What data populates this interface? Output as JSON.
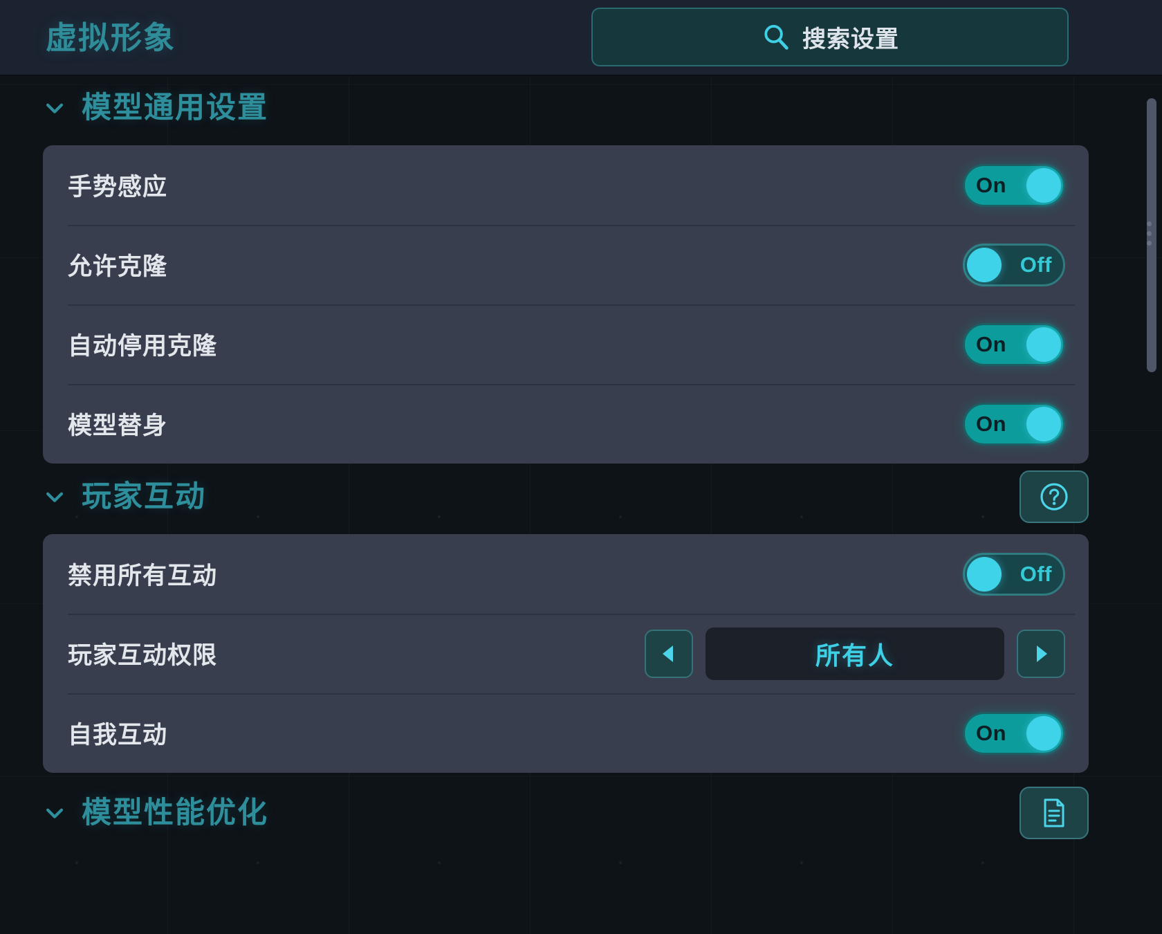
{
  "header": {
    "title": "虚拟形象",
    "search": {
      "label": "搜索设置",
      "icon": "search-icon"
    }
  },
  "theme": {
    "accent_teal": "#2e8e9b",
    "accent_cyan": "#3fd0e6",
    "toggle_on_bg": "#0d9c9c",
    "toggle_off_bg": "#17454a",
    "card_bg": "#383e4d",
    "header_bg": "#1b2230",
    "page_bg": "#0e1318"
  },
  "sections": [
    {
      "title": "模型通用设置",
      "chevron": "chevron-down-icon",
      "action_icon": null,
      "rows": [
        {
          "label": "手势感应",
          "type": "toggle",
          "state": "On",
          "state_label": "On"
        },
        {
          "label": "允许克隆",
          "type": "toggle",
          "state": "Off",
          "state_label": "Off"
        },
        {
          "label": "自动停用克隆",
          "type": "toggle",
          "state": "On",
          "state_label": "On"
        },
        {
          "label": "模型替身",
          "type": "toggle",
          "state": "On",
          "state_label": "On"
        }
      ]
    },
    {
      "title": "玩家互动",
      "chevron": "chevron-down-icon",
      "action_icon": "help-icon",
      "rows": [
        {
          "label": "禁用所有互动",
          "type": "toggle",
          "state": "Off",
          "state_label": "Off"
        },
        {
          "label": "玩家互动权限",
          "type": "stepper",
          "value": "所有人",
          "prev_icon": "triangle-left-icon",
          "next_icon": "triangle-right-icon"
        },
        {
          "label": "自我互动",
          "type": "toggle",
          "state": "On",
          "state_label": "On"
        }
      ]
    },
    {
      "title": "模型性能优化",
      "chevron": "chevron-down-icon",
      "action_icon": "document-icon",
      "rows": []
    }
  ],
  "scrollbar": {
    "name": "vertical-scrollbar",
    "grip": "scroll-grip-dots"
  }
}
